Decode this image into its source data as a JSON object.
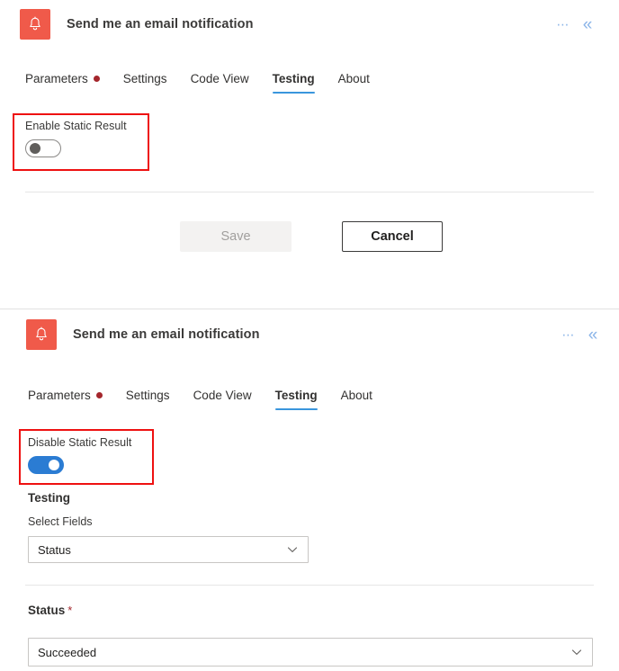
{
  "cards": [
    {
      "header": {
        "icon": "bell-icon",
        "title": "Send me an email notification",
        "more_icon": "ellipsis-icon",
        "more_label": "⋯",
        "collapse_icon": "double-chevron-left-icon",
        "collapse_label": "«"
      },
      "tabs": [
        {
          "label": "Parameters",
          "selected": false,
          "dot": true
        },
        {
          "label": "Settings",
          "selected": false,
          "dot": false
        },
        {
          "label": "Code View",
          "selected": false,
          "dot": false
        },
        {
          "label": "Testing",
          "selected": true,
          "dot": false
        },
        {
          "label": "About",
          "selected": false,
          "dot": false
        }
      ],
      "toggle": {
        "label": "Enable Static Result",
        "state": "off"
      },
      "buttons": {
        "save_label": "Save",
        "save_disabled": true,
        "cancel_label": "Cancel"
      }
    },
    {
      "header": {
        "icon": "bell-icon",
        "title": "Send me an email notification",
        "more_icon": "ellipsis-icon",
        "more_label": "⋯",
        "collapse_icon": "double-chevron-left-icon",
        "collapse_label": "«"
      },
      "tabs": [
        {
          "label": "Parameters",
          "selected": false,
          "dot": true
        },
        {
          "label": "Settings",
          "selected": false,
          "dot": false
        },
        {
          "label": "Code View",
          "selected": false,
          "dot": false
        },
        {
          "label": "Testing",
          "selected": true,
          "dot": false
        },
        {
          "label": "About",
          "selected": false,
          "dot": false
        }
      ],
      "toggle": {
        "label": "Disable Static Result",
        "state": "on"
      },
      "testing_heading": "Testing",
      "select_fields": {
        "label": "Select Fields",
        "value": "Status",
        "chevron": "chevron-down-icon"
      },
      "status": {
        "label": "Status",
        "required_marker": "*",
        "value": "Succeeded",
        "chevron": "chevron-down-icon"
      }
    }
  ],
  "colors": {
    "app_icon_bg": "#f05a4a",
    "tab_accent": "#3a96dd",
    "tab_dot": "#a4262c",
    "toggle_on": "#2b7cd3",
    "annotation": "#ee1111",
    "required": "#a4262c",
    "header_icon": "#8ab4e8"
  }
}
